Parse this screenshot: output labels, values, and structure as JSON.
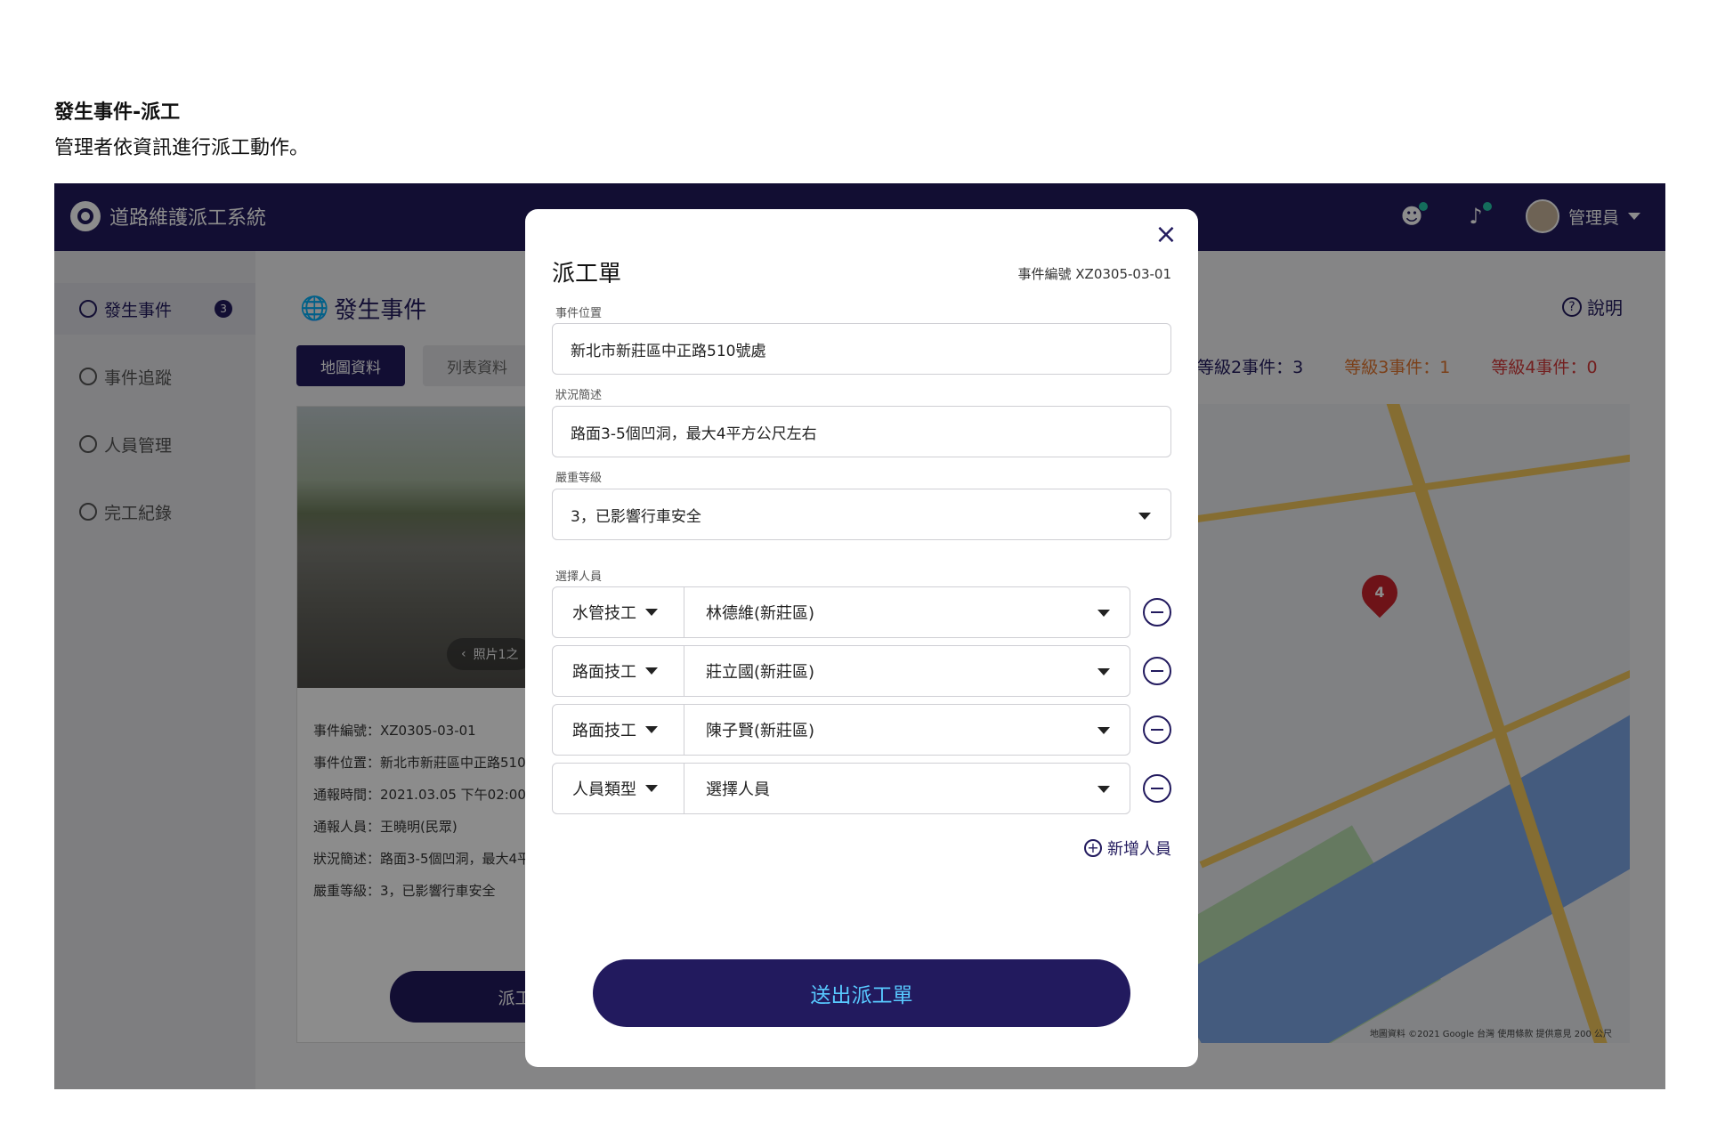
{
  "caption": {
    "title": "發生事件-派工",
    "subtitle": "管理者依資訊進行派工動作。"
  },
  "app": {
    "brand": "道路維護派工系統",
    "user": "管理員",
    "sidebar": [
      {
        "label": "發生事件",
        "badge": "3"
      },
      {
        "label": "事件追蹤"
      },
      {
        "label": "人員管理"
      },
      {
        "label": "完工紀錄"
      }
    ],
    "page_title": "發生事件",
    "help": "說明",
    "tabs": [
      "地圖資料",
      "列表資料"
    ],
    "levels": [
      "等級2事件：3",
      "等級3事件：1",
      "等級4事件：0"
    ],
    "photo_tag": "照片1之",
    "event_info": [
      "事件編號：XZ0305-03-01",
      "事件位置：新北市新莊區中正路510",
      "通報時間：2021.03.05 下午02:00",
      "通報人員：王曉明(民眾)",
      "狀況簡述：路面3-5個凹洞，最大4平",
      "嚴重等級：3，已影響行車安全"
    ],
    "dispatch_button": "派工處",
    "map_pin": "4",
    "map_credit": "地圖資料 ©2021 Google  台灣  使用條款  提供意見  200 公尺"
  },
  "modal": {
    "title": "派工單",
    "event_code": "事件編號 XZ0305-03-01",
    "location_label": "事件位置",
    "location_value": "新北市新莊區中正路510號處",
    "summary_label": "狀況簡述",
    "summary_value": "路面3-5個凹洞，最大4平方公尺左右",
    "severity_label": "嚴重等級",
    "severity_value": "3，已影響行車安全",
    "staff_label": "選擇人員",
    "staff": [
      {
        "role": "水管技工",
        "person": "林德維(新莊區)"
      },
      {
        "role": "路面技工",
        "person": "莊立國(新莊區)"
      },
      {
        "role": "路面技工",
        "person": "陳子賢(新莊區)"
      },
      {
        "role": "人員類型",
        "person": "選擇人員"
      }
    ],
    "add_person": "新增人員",
    "submit": "送出派工單"
  }
}
